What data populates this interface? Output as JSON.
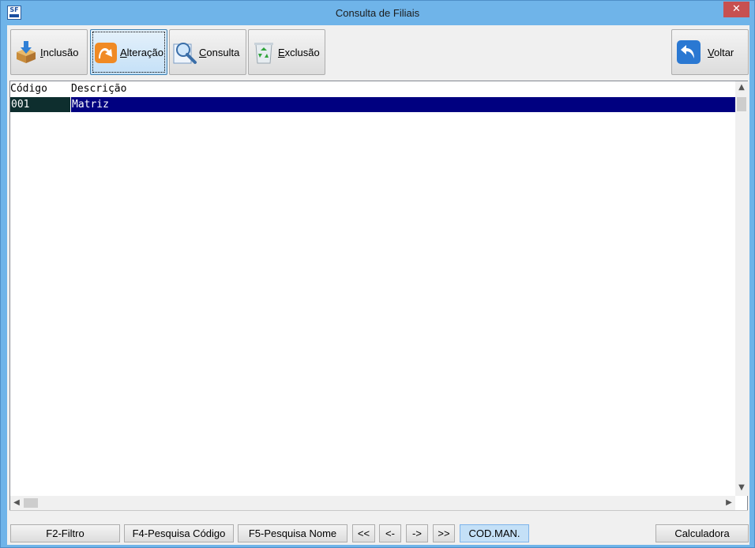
{
  "window": {
    "title": "Consulta  de Filiais",
    "close_symbol": "✕",
    "app_icon_text": "SF"
  },
  "toolbar": {
    "buttons": [
      {
        "mnemonic": "I",
        "rest": "nclusão",
        "icon": "box-download-icon"
      },
      {
        "mnemonic": "A",
        "rest": "lteração",
        "icon": "edit-orange-icon"
      },
      {
        "mnemonic": "C",
        "rest": "onsulta",
        "icon": "magnifier-icon"
      },
      {
        "mnemonic": "E",
        "rest": "xclusão",
        "icon": "recycle-bin-icon"
      }
    ],
    "back": {
      "mnemonic": "V",
      "rest": "oltar",
      "icon": "back-arrow-icon"
    }
  },
  "grid": {
    "columns": [
      "Código",
      "Descrição"
    ],
    "rows": [
      {
        "code": "001",
        "description": "Matriz"
      }
    ]
  },
  "footer": {
    "filter": "F2-Filtro",
    "search_code": "F4-Pesquisa Código",
    "search_name": "F5-Pesquisa Nome",
    "first": "<<",
    "prev": "<-",
    "next": "->",
    "last": ">>",
    "cod_man": "COD.MAN.",
    "calculator": "Calculadora"
  },
  "colors": {
    "selected_row": "#000080",
    "selected_code_cell": "#0e2e2e",
    "title_bar": "#6fb4e9",
    "close_button": "#c75050"
  }
}
